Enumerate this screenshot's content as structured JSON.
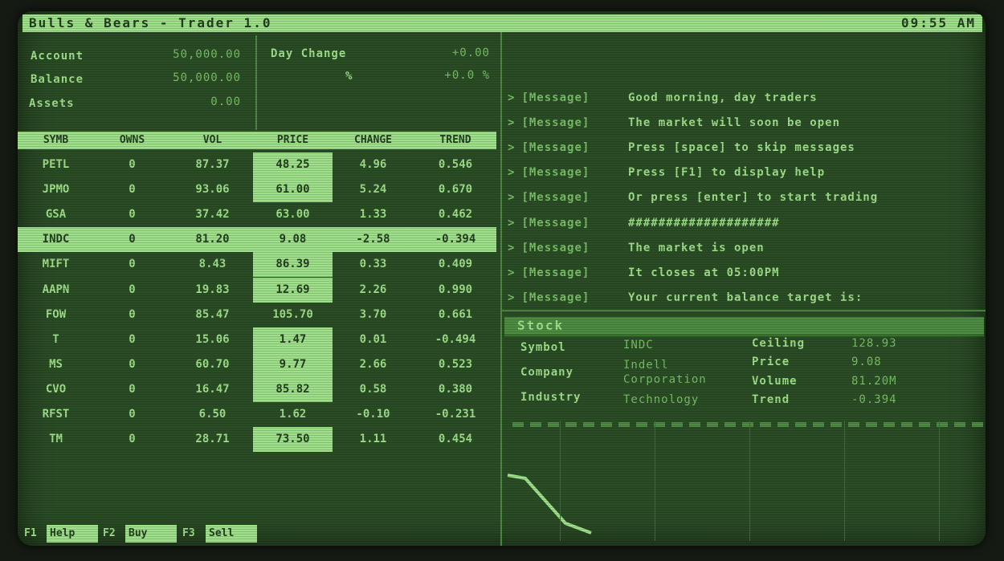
{
  "app": {
    "title": "Bulls & Bears - Trader 1.0",
    "clock": "09:55 AM"
  },
  "account": {
    "account_label": "Account",
    "account_value": "50,000.00",
    "balance_label": "Balance",
    "balance_value": "50,000.00",
    "assets_label": "Assets",
    "assets_value": "0.00",
    "day_change_label": "Day Change",
    "day_change_value": "+0.00",
    "pct_label": "%",
    "pct_value": "+0.0 %"
  },
  "table": {
    "headers": [
      "SYMB",
      "OWNS",
      "VOL",
      "PRICE",
      "CHANGE",
      "TREND"
    ],
    "rows": [
      {
        "symb": "PETL",
        "owns": "0",
        "vol": "87.37",
        "price": "48.25",
        "change": "4.96",
        "trend": "0.546"
      },
      {
        "symb": "JPMO",
        "owns": "0",
        "vol": "93.06",
        "price": "61.00",
        "change": "5.24",
        "trend": "0.670"
      },
      {
        "symb": "GSA",
        "owns": "0",
        "vol": "37.42",
        "price": "63.00",
        "change": "1.33",
        "trend": "0.462"
      },
      {
        "symb": "INDC",
        "owns": "0",
        "vol": "81.20",
        "price": "9.08",
        "change": "-2.58",
        "trend": "-0.394"
      },
      {
        "symb": "MIFT",
        "owns": "0",
        "vol": "8.43",
        "price": "86.39",
        "change": "0.33",
        "trend": "0.409"
      },
      {
        "symb": "AAPN",
        "owns": "0",
        "vol": "19.83",
        "price": "12.69",
        "change": "2.26",
        "trend": "0.990"
      },
      {
        "symb": "FOW",
        "owns": "0",
        "vol": "85.47",
        "price": "105.70",
        "change": "3.70",
        "trend": "0.661"
      },
      {
        "symb": "T",
        "owns": "0",
        "vol": "15.06",
        "price": "1.47",
        "change": "0.01",
        "trend": "-0.494"
      },
      {
        "symb": "MS",
        "owns": "0",
        "vol": "60.70",
        "price": "9.77",
        "change": "2.66",
        "trend": "0.523"
      },
      {
        "symb": "CVO",
        "owns": "0",
        "vol": "16.47",
        "price": "85.82",
        "change": "0.58",
        "trend": "0.380"
      },
      {
        "symb": "RFST",
        "owns": "0",
        "vol": "6.50",
        "price": "1.62",
        "change": "-0.10",
        "trend": "-0.231"
      },
      {
        "symb": "TM",
        "owns": "0",
        "vol": "28.71",
        "price": "73.50",
        "change": "1.11",
        "trend": "0.454"
      }
    ]
  },
  "messages": [
    {
      "chev": ">",
      "tag": "[Message]",
      "text": "Good morning, day traders"
    },
    {
      "chev": ">",
      "tag": "[Message]",
      "text": "The market will soon be open"
    },
    {
      "chev": ">",
      "tag": "[Message]",
      "text": "Press [space] to skip messages"
    },
    {
      "chev": ">",
      "tag": "[Message]",
      "text": "Press [F1] to display help"
    },
    {
      "chev": ">",
      "tag": "[Message]",
      "text": "Or press [enter] to start trading"
    },
    {
      "chev": ">",
      "tag": "[Message]",
      "text": "####################"
    },
    {
      "chev": ">",
      "tag": "[Message]",
      "text": "The market is open"
    },
    {
      "chev": ">",
      "tag": "[Message]",
      "text": "It closes at 05:00PM"
    },
    {
      "chev": ">",
      "tag": "[Message]",
      "text": "Your current balance target is:"
    }
  ],
  "stock": {
    "heading": "Stock",
    "symbol_label": "Symbol",
    "symbol_value": "INDC",
    "company_label": "Company",
    "company_value_1": "Indell",
    "company_value_2": "Corporation",
    "industry_label": "Industry",
    "industry_value": "Technology",
    "ceiling_label": "Ceiling",
    "ceiling_value": "128.93",
    "price_label": "Price",
    "price_value": "9.08",
    "volume_label": "Volume",
    "volume_value": "81.20M",
    "trend_label": "Trend",
    "trend_value": "-0.394"
  },
  "function_keys": [
    {
      "key": "F1",
      "label": "Help"
    },
    {
      "key": "F2",
      "label": "Buy"
    },
    {
      "key": "F3",
      "label": "Sell"
    }
  ],
  "colors": {
    "phosphor": "#9fe08a",
    "background": "#2b4d26",
    "dim": "#4f8b43"
  }
}
